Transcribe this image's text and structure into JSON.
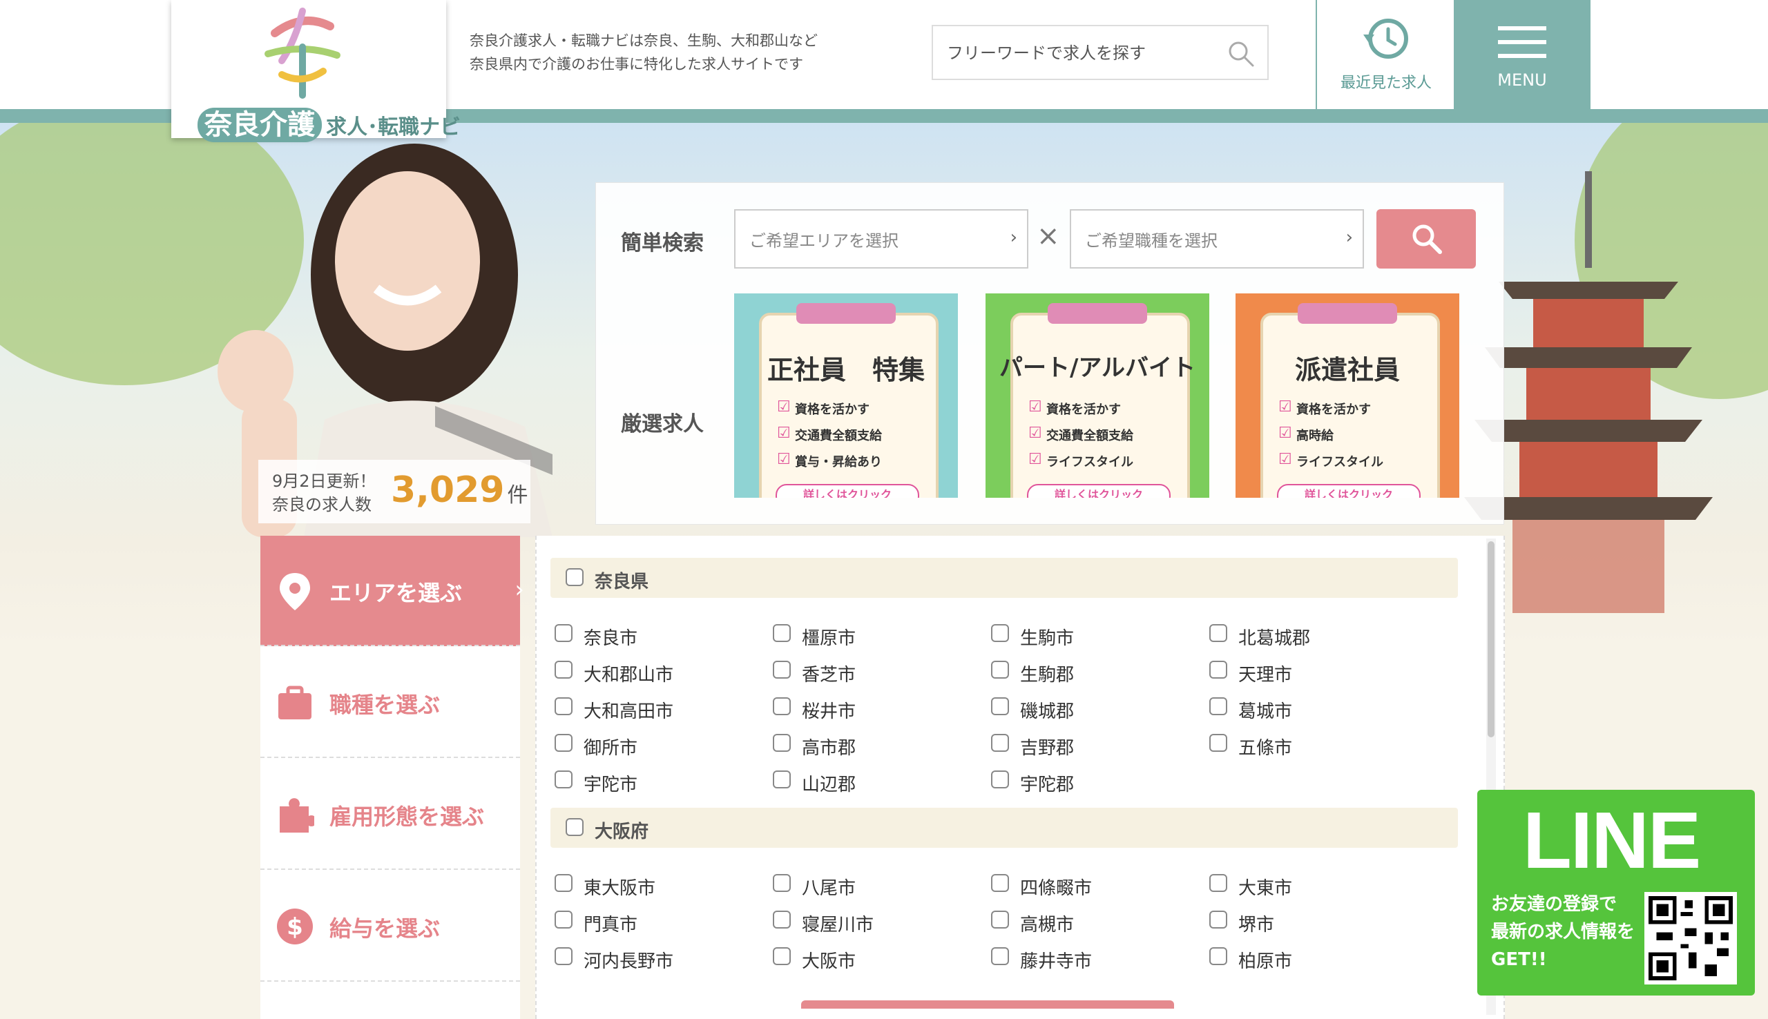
{
  "header": {
    "logo_text": "奈良介護",
    "logo_sub": "求人･転職ナビ",
    "tagline_line1": "奈良介護求人・転職ナビは奈良、生駒、大和郡山など",
    "tagline_line2": "奈良県内で介護のお仕事に特化した求人サイトです",
    "search_placeholder": "フリーワードで求人を探す",
    "recent_label": "最近見た求人",
    "menu_label": "MENU"
  },
  "hero": {
    "update_line1": "9月2日更新！",
    "update_line2": "奈良の求人数",
    "job_count": "3,029",
    "job_count_unit": "件"
  },
  "simple_search": {
    "label": "簡単検索",
    "area_placeholder": "ご希望エリアを選択",
    "job_placeholder": "ご希望職種を選択"
  },
  "featured": {
    "label": "厳選求人",
    "banners": [
      {
        "title": "正社員　特集",
        "items": [
          "資格を活かす",
          "交通費全額支給",
          "賞与・昇給あり"
        ],
        "footer": "詳しくはクリック",
        "color": "#8fd3d3"
      },
      {
        "title": "パート/アルバイト",
        "items": [
          "資格を活かす",
          "交通費全額支給",
          "ライフスタイル"
        ],
        "footer": "詳しくはクリック",
        "color": "#7ccd5c"
      },
      {
        "title": "派遣社員",
        "items": [
          "資格を活かす",
          "高時給",
          "ライフスタイル"
        ],
        "footer": "詳しくはクリック",
        "color": "#f08a4b"
      }
    ]
  },
  "tabs": [
    {
      "label": "エリアを選ぶ",
      "icon": "map-pin-icon"
    },
    {
      "label": "職種を選ぶ",
      "icon": "briefcase-icon"
    },
    {
      "label": "雇用形態を選ぶ",
      "icon": "puzzle-icon"
    },
    {
      "label": "給与を選ぶ",
      "icon": "dollar-icon"
    }
  ],
  "areas": [
    {
      "prefecture": "奈良県",
      "cities": [
        "奈良市",
        "橿原市",
        "生駒市",
        "北葛城郡",
        "大和郡山市",
        "香芝市",
        "生駒郡",
        "天理市",
        "大和高田市",
        "桜井市",
        "磯城郡",
        "葛城市",
        "御所市",
        "高市郡",
        "吉野郡",
        "五條市",
        "宇陀市",
        "山辺郡",
        "宇陀郡"
      ]
    },
    {
      "prefecture": "大阪府",
      "cities": [
        "東大阪市",
        "八尾市",
        "四條畷市",
        "大東市",
        "門真市",
        "寝屋川市",
        "高槻市",
        "堺市",
        "河内長野市",
        "大阪市",
        "藤井寺市",
        "柏原市"
      ]
    }
  ],
  "line_banner": {
    "logo": "LINE",
    "text_line1": "お友達の登録で",
    "text_line2": "最新の求人情報を",
    "text_line3": "GET!!"
  },
  "colors": {
    "accent_pink": "#e58a8e",
    "teal": "#7fb3ad",
    "count_orange": "#e29b2f",
    "line_green": "#55c43c"
  }
}
